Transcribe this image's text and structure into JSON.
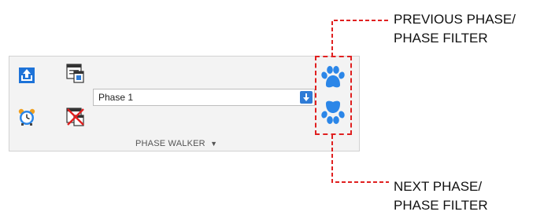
{
  "phase_walker": {
    "selected_phase": "Phase 1",
    "panel_label": "PHASE WALKER",
    "panel_menu_glyph": "▼",
    "tools": [
      {
        "icon": "export-up-icon"
      },
      {
        "icon": "phase-window-icon"
      },
      {
        "icon": "alarm-clock-icon"
      },
      {
        "icon": "phase-filter-off-icon"
      }
    ],
    "dropdown_icon": "chevron-down-icon"
  },
  "callouts": {
    "previous_line1": "PREVIOUS PHASE/",
    "previous_line2": "PHASE FILTER",
    "next_line1": "NEXT PHASE/",
    "next_line2": "PHASE FILTER"
  },
  "colors": {
    "accent_blue": "#2e7bd6",
    "paw_blue": "#2b86e8",
    "highlight_red": "#e02020"
  }
}
